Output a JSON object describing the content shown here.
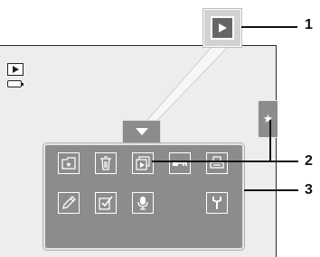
{
  "callouts": [
    "1",
    "2",
    "3"
  ],
  "icons": {
    "mode": "playback-mode-icon",
    "battery": "battery-icon",
    "favorite_tab": "star-icon",
    "play_zoom": "play-icon",
    "menu_tab": "chevron-down-icon"
  },
  "menu_buttons": [
    {
      "icon": "favorites-folder-icon"
    },
    {
      "icon": "trash-icon"
    },
    {
      "icon": "slideshow-icon"
    },
    {
      "icon": "protect-key-icon"
    },
    {
      "icon": "print-order-icon"
    },
    {
      "icon": "pencil-retouch-icon"
    },
    {
      "icon": "edit-check-icon"
    },
    {
      "icon": "voice-memo-icon"
    },
    {
      "icon": "setup-wrench-icon"
    }
  ],
  "colors": {
    "panel": "#8c8c8c",
    "screen": "#ededed",
    "line": "#111111"
  }
}
